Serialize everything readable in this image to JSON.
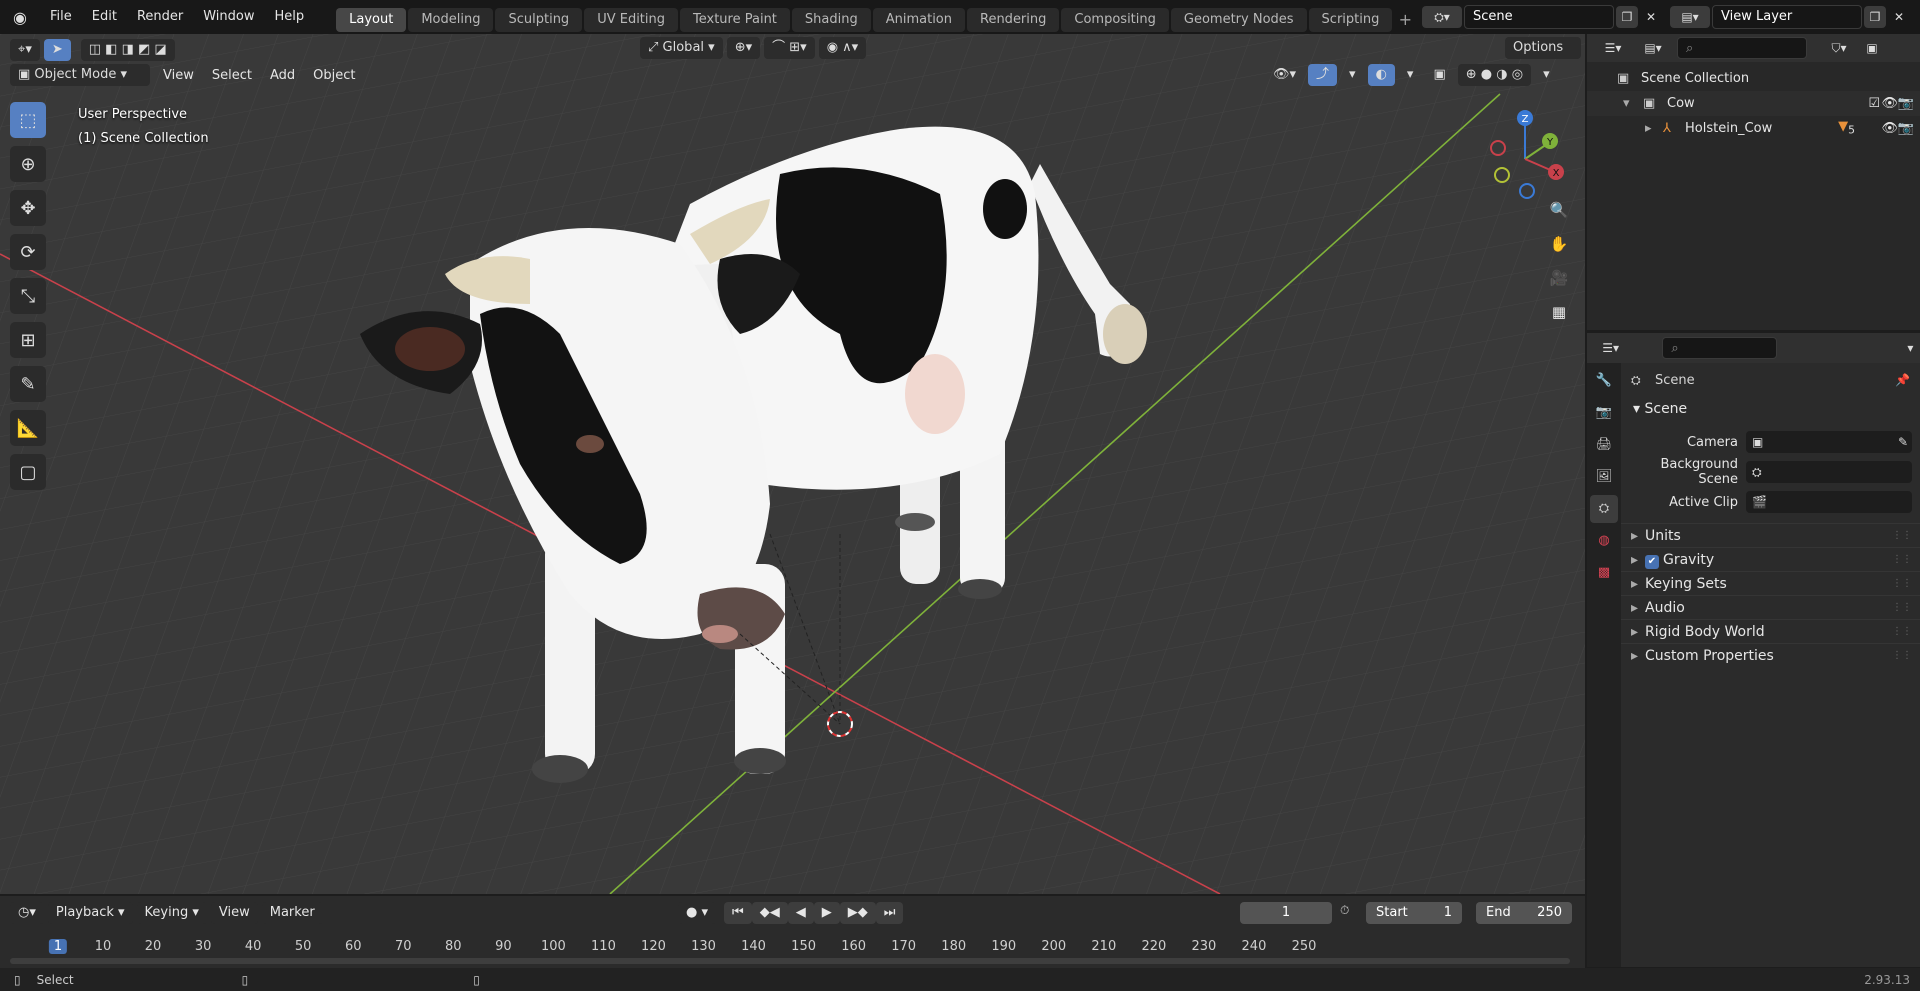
{
  "app": {
    "menus": [
      "File",
      "Edit",
      "Render",
      "Window",
      "Help"
    ],
    "workspaces": [
      "Layout",
      "Modeling",
      "Sculpting",
      "UV Editing",
      "Texture Paint",
      "Shading",
      "Animation",
      "Rendering",
      "Compositing",
      "Geometry Nodes",
      "Scripting"
    ],
    "active_workspace": "Layout",
    "scene": "Scene",
    "view_layer": "View Layer"
  },
  "viewport": {
    "mode": "Object Mode",
    "menus": [
      "View",
      "Select",
      "Add",
      "Object"
    ],
    "transform_orientation": "Global",
    "options_label": "Options",
    "perspective_label": "User Perspective",
    "collection_label": "(1) Scene Collection",
    "gizmo_axes": {
      "z": "Z",
      "y": "Y",
      "x": "X"
    },
    "colors": {
      "x_axis": "#c9414b",
      "y_axis": "#7fb23a",
      "z_axis": "#3a7ad6",
      "active_tool": "#5680c2"
    }
  },
  "outliner": {
    "root": "Scene Collection",
    "collection": "Cow",
    "object": "Holstein_Cow",
    "modifier_count": "5"
  },
  "properties": {
    "context": "Scene",
    "panel": "Scene",
    "fields": {
      "camera": "Camera",
      "background_scene": "Background Scene",
      "active_clip": "Active Clip"
    },
    "subpanels": [
      "Units",
      "Gravity",
      "Keying Sets",
      "Audio",
      "Rigid Body World",
      "Custom Properties"
    ],
    "gravity_checked": true
  },
  "timeline": {
    "menus": [
      "Playback",
      "Keying",
      "View",
      "Marker"
    ],
    "current_frame": "1",
    "start_label": "Start",
    "start": "1",
    "end_label": "End",
    "end": "250",
    "ruler": [
      "1",
      "10",
      "20",
      "30",
      "40",
      "50",
      "60",
      "70",
      "80",
      "90",
      "100",
      "110",
      "120",
      "130",
      "140",
      "150",
      "160",
      "170",
      "180",
      "190",
      "200",
      "210",
      "220",
      "230",
      "240",
      "250"
    ]
  },
  "status": {
    "left": "Select",
    "version": "2.93.13"
  }
}
